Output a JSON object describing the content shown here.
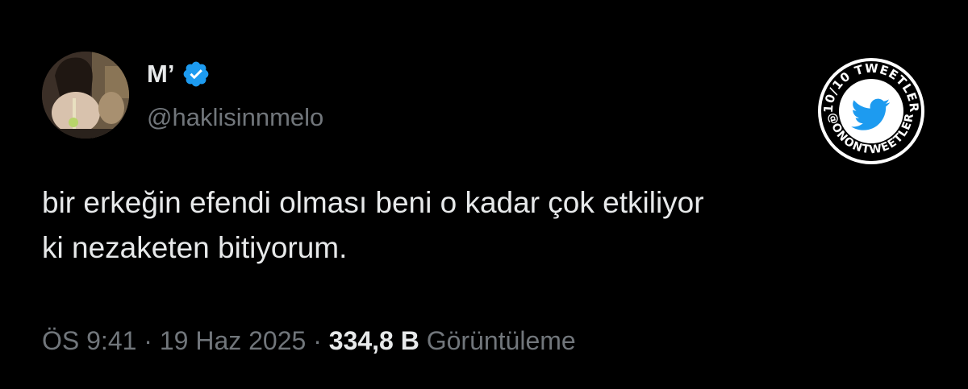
{
  "user": {
    "display_name": "M’",
    "handle": "@haklisinnmelo",
    "verified": true
  },
  "tweet": {
    "text_lines": [
      "bir erkeğin efendi olması beni o kadar çok etkiliyor",
      "ki nezaketen bitiyorum."
    ]
  },
  "meta": {
    "time": "ÖS 9:41",
    "separator": "·",
    "date": "19 Haz 2025",
    "views": "334,8 B",
    "views_label": "Görüntüleme"
  },
  "watermark": {
    "top_text": "10/10 TWEETLER",
    "bottom_text": "@ONONTWEETLER",
    "icon": "twitter-bird-icon"
  },
  "colors": {
    "background": "#000000",
    "text": "#e7e9ea",
    "secondary": "#71767b",
    "verified": "#1d9bf0"
  }
}
